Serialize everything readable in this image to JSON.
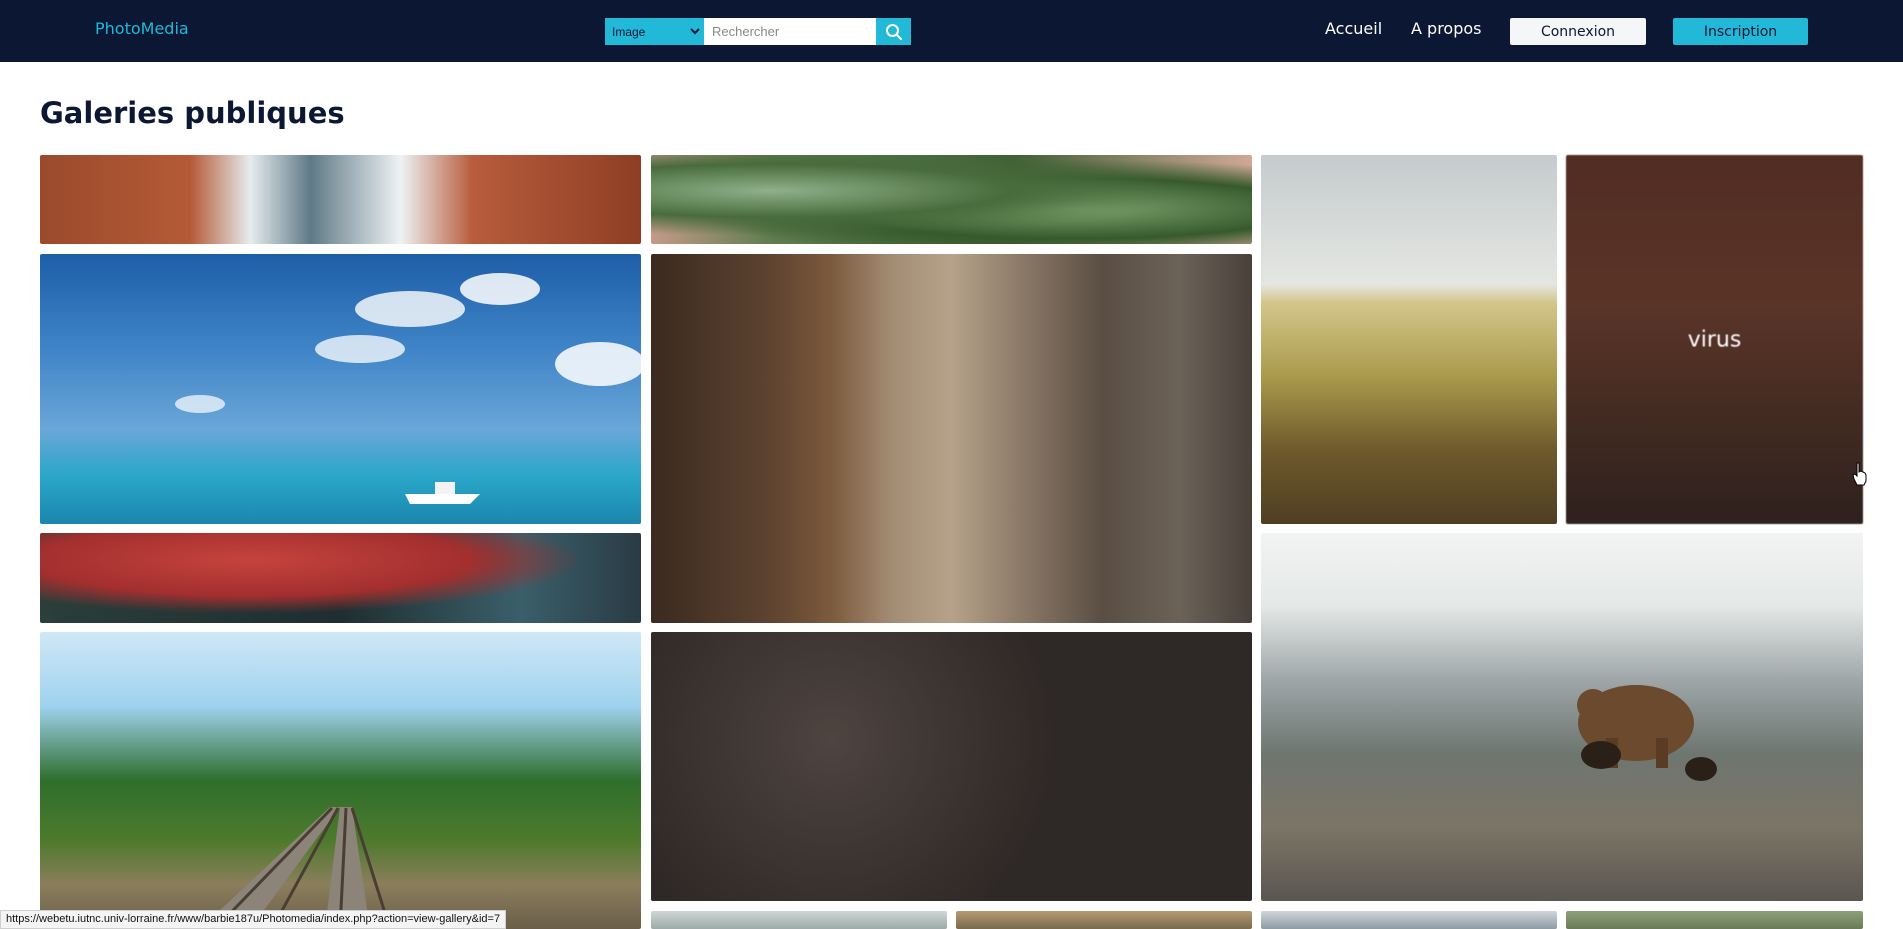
{
  "navbar": {
    "brand": "PhotoMedia",
    "search": {
      "type_selected": "Image",
      "placeholder": "Rechercher"
    },
    "links": [
      "Accueil",
      "A propos"
    ],
    "login_label": "Connexion",
    "signup_label": "Inscription"
  },
  "page": {
    "title": "Galeries publiques"
  },
  "gallery": [
    {
      "name": "gallery-bridge-brick",
      "caption": ""
    },
    {
      "name": "gallery-pine-needles",
      "caption": ""
    },
    {
      "name": "gallery-wheat-field",
      "caption": ""
    },
    {
      "name": "gallery-virus",
      "caption": "virus"
    },
    {
      "name": "gallery-sea-boat",
      "caption": ""
    },
    {
      "name": "gallery-buildings-alley",
      "caption": ""
    },
    {
      "name": "gallery-red-umbrella",
      "caption": ""
    },
    {
      "name": "gallery-bear-mountain",
      "caption": ""
    },
    {
      "name": "gallery-railway",
      "caption": ""
    },
    {
      "name": "gallery-dark-pebbles",
      "caption": ""
    }
  ],
  "status_bar": {
    "url": "https://webetu.iutnc.univ-lorraine.fr/www/barbie187u/Photomedia/index.php?action=view-gallery&id=7"
  },
  "colors": {
    "navbar_bg": "#0b1733",
    "accent": "#22b8d8",
    "title": "#0b1733"
  },
  "icons": [
    "search-icon",
    "hand-cursor-icon"
  ]
}
